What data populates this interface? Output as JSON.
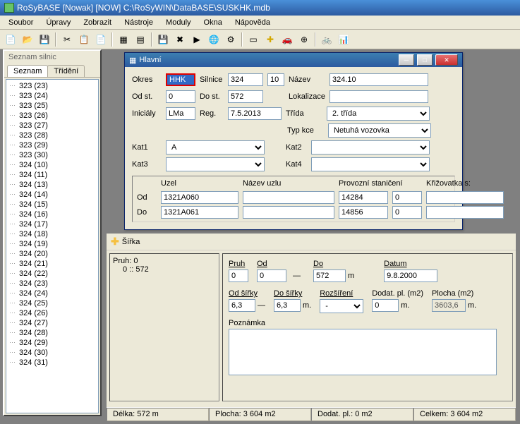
{
  "app": {
    "title": "RoSyBASE  [Nowak]  [NOW]   C:\\RoSyWIN\\DataBASE\\SUSKHK.mdb"
  },
  "menu": [
    "Soubor",
    "Úpravy",
    "Zobrazit",
    "Nástroje",
    "Moduly",
    "Okna",
    "Nápověda"
  ],
  "sidebar": {
    "title": "Seznam silnic",
    "tabs": [
      "Seznam",
      "Třídění"
    ],
    "items": [
      "323 (23)",
      "323 (24)",
      "323 (25)",
      "323 (26)",
      "323 (27)",
      "323 (28)",
      "323 (29)",
      "323 (30)",
      "324 (10)",
      "324 (11)",
      "324 (13)",
      "324 (14)",
      "324 (15)",
      "324 (16)",
      "324 (17)",
      "324 (18)",
      "324 (19)",
      "324 (20)",
      "324 (21)",
      "324 (22)",
      "324 (23)",
      "324 (24)",
      "324 (25)",
      "324 (26)",
      "324 (27)",
      "324 (28)",
      "324 (29)",
      "324 (30)",
      "324 (31)"
    ]
  },
  "hlavni": {
    "title": "Hlavní",
    "labels": {
      "okres": "Okres",
      "silnice": "Silnice",
      "nazev": "Název",
      "odst": "Od st.",
      "dost": "Do st.",
      "lokalizace": "Lokalizace",
      "inicialy": "Iniciály",
      "reg": "Reg.",
      "trida": "Třída",
      "typkce": "Typ kce",
      "kat1": "Kat1",
      "kat2": "Kat2",
      "kat3": "Kat3",
      "kat4": "Kat4",
      "uzel": "Uzel",
      "nazevuzlu": "Název uzlu",
      "provstan": "Provozní staničení",
      "kriz": "Křižovatka s:",
      "od": "Od",
      "do": "Do"
    },
    "okres": "HHK",
    "silnice": "324",
    "silnice_b": "10",
    "nazev": "324.10",
    "odst": "0",
    "dost": "572",
    "lokalizace": "",
    "inicialy": "LMa",
    "reg": "7.5.2013",
    "trida": "2. třída",
    "typkce": "Netuhá vozovka",
    "kat1": "A",
    "kat2": "",
    "kat3": "",
    "kat4": "",
    "od_uzel": "1321A060",
    "od_nazev": "",
    "od_prov": "14284",
    "od_prov2": "0",
    "od_kriz": "",
    "do_uzel": "1321A061",
    "do_nazev": "",
    "do_prov": "14856",
    "do_prov2": "0",
    "do_kriz": ""
  },
  "sirka": {
    "title": "Šířka",
    "tree": [
      "Pruh: 0",
      "   0 :: 572"
    ],
    "labels": {
      "pruh": "Pruh",
      "od": "Od",
      "do": "Do",
      "datum": "Datum",
      "odsirky": "Od šířky",
      "dosirky": "Do šířky",
      "rozsireni": "Rozšíření",
      "dodatpl": "Dodat. pl. (m2)",
      "plocha": "Plocha (m2)",
      "poznamka": "Poznámka"
    },
    "pruh": "0",
    "od": "0",
    "do": "572",
    "m": "m",
    "datum": "9.8.2000",
    "odsirky": "6,3",
    "dosirky": "6,3",
    "rozsireni": "-",
    "dodatpl": "0",
    "mu": "m.",
    "plocha": "3603,6",
    "poznamka": ""
  },
  "status": {
    "delka": "Délka: 572 m",
    "plocha": "Plocha: 3 604 m2",
    "dodat": "Dodat. pl.: 0 m2",
    "celkem": "Celkem: 3 604 m2"
  },
  "chart_data": null
}
